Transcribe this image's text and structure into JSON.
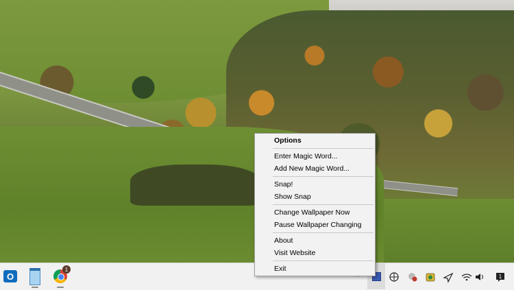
{
  "context_menu": {
    "title": "Options",
    "items": [
      "Enter Magic Word...",
      "Add New Magic Word...",
      "Snap!",
      "Show Snap",
      "Change Wallpaper Now",
      "Pause Wallpaper Changing",
      "About",
      "Visit Website",
      "Exit"
    ]
  },
  "taskbar": {
    "apps": [
      {
        "name": "Outlook",
        "icon": "outlook-icon",
        "glyph": "O"
      },
      {
        "name": "Notepad",
        "icon": "notepad-icon"
      },
      {
        "name": "Chrome",
        "icon": "chrome-icon",
        "badge": "1"
      }
    ],
    "tray": {
      "chevron": "^",
      "icons": [
        "magic-word-tray-icon",
        "globe-icon",
        "security-icon",
        "drive-lock-icon",
        "location-icon",
        "wifi-icon",
        "volume-icon",
        "notification-icon"
      ]
    }
  }
}
